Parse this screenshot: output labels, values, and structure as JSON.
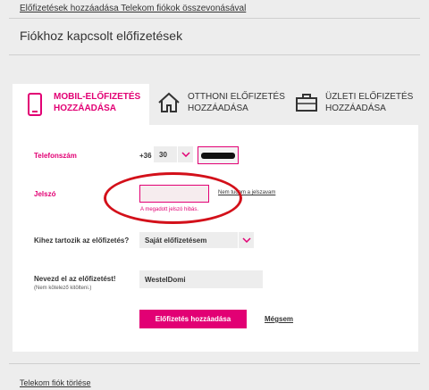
{
  "header": {
    "top_link": "Előfizetések hozzáadása Telekom fiókok összevonásával",
    "title": "Fiókhoz kapcsolt előfizetések"
  },
  "tabs": [
    {
      "label_line1": "MOBIL-ELŐFIZETÉS",
      "label_line2": "HOZZÁADÁSA",
      "icon": "mobile-phone-icon",
      "active": true
    },
    {
      "label_line1": "OTTHONI ELŐFIZETÉS",
      "label_line2": "HOZZÁADÁSA",
      "icon": "house-icon",
      "active": false
    },
    {
      "label_line1": "ÜZLETI ELŐFIZETÉS",
      "label_line2": "HOZZÁADÁSA",
      "icon": "briefcase-icon",
      "active": false
    }
  ],
  "form": {
    "phone_label": "Telefonszám",
    "phone_prefix": "+36",
    "area_code": "30",
    "password_label": "Jelszó",
    "forgot_password": "Nem tudom a jelszavam",
    "password_error": "A megadott jelszó hibás.",
    "owner_label": "Kihez tartozik az előfizetés?",
    "owner_value": "Saját előfizetésem",
    "nickname_label": "Nevezd el az előfizetést!",
    "nickname_sublabel": "(Nem kötelező kitölteni.)",
    "nickname_value": "WestelDomi",
    "submit_label": "Előfizetés hozzáadása",
    "cancel_label": "Mégsem"
  },
  "footer": {
    "delete_link": "Telekom fiók törlése"
  },
  "colors": {
    "accent": "#e20074",
    "annotation": "#d3101a"
  }
}
